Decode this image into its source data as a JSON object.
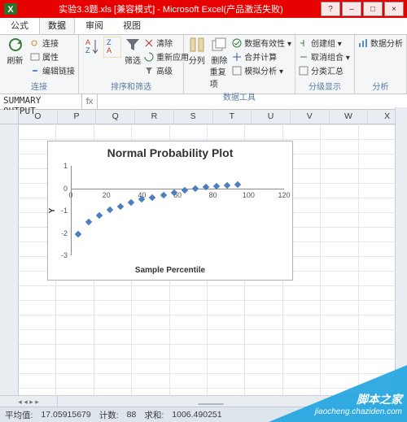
{
  "title": "实验3.3题.xls  [兼容模式] - Microsoft Excel(产品激活失败)",
  "winbtns": {
    "help": "?",
    "min": "–",
    "max": "□",
    "close": "×"
  },
  "tabs": {
    "t1": "公式",
    "t2": "数据",
    "t3": "审阅",
    "t4": "视图"
  },
  "ribbon": {
    "g1": {
      "big": "刷新",
      "r1": "连接",
      "r2": "属性",
      "r3": "编辑链接",
      "label": "连接"
    },
    "g2": {
      "filter": "筛选",
      "clear": "清除",
      "reapply": "重新应用",
      "adv": "高级",
      "label": "排序和筛选"
    },
    "g3": {
      "col1": "分列",
      "col2": "删除",
      "col3": "重复项",
      "label": "数据工具",
      "v1": "数据有效性 ▾",
      "v2": "合并计算",
      "v3": "模拟分析 ▾"
    },
    "g4": {
      "v1": "创建组 ▾",
      "v2": "取消组合 ▾",
      "v3": "分类汇总",
      "label": "分级显示"
    },
    "g5": {
      "v1": "数据分析",
      "label": "分析"
    }
  },
  "formula": {
    "name": "SUMMARY OUTPUT",
    "fx": "fx"
  },
  "cols": [
    "O",
    "P",
    "Q",
    "R",
    "S",
    "T",
    "U",
    "V",
    "W",
    "X"
  ],
  "cell_a": "",
  "chart_data": {
    "type": "scatter",
    "title": "Normal Probability Plot",
    "xlabel": "Sample Percentile",
    "ylabel": "Y",
    "xlim": [
      0,
      120
    ],
    "ylim": [
      -3,
      1
    ],
    "xticks": [
      0,
      20,
      40,
      60,
      80,
      100,
      120
    ],
    "yticks": [
      -3,
      -2,
      -1,
      0,
      1
    ],
    "points": [
      {
        "x": 4,
        "y": -2.05
      },
      {
        "x": 10,
        "y": -1.5
      },
      {
        "x": 16,
        "y": -1.2
      },
      {
        "x": 22,
        "y": -0.95
      },
      {
        "x": 28,
        "y": -0.8
      },
      {
        "x": 34,
        "y": -0.65
      },
      {
        "x": 40,
        "y": -0.5
      },
      {
        "x": 46,
        "y": -0.4
      },
      {
        "x": 52,
        "y": -0.3
      },
      {
        "x": 58,
        "y": -0.2
      },
      {
        "x": 64,
        "y": -0.1
      },
      {
        "x": 70,
        "y": -0.02
      },
      {
        "x": 76,
        "y": 0.05
      },
      {
        "x": 82,
        "y": 0.1
      },
      {
        "x": 88,
        "y": 0.13
      },
      {
        "x": 94,
        "y": 0.15
      }
    ]
  },
  "status": {
    "avg_l": "平均值:",
    "avg_v": "17.05915679",
    "cnt_l": "计数:",
    "cnt_v": "88",
    "sum_l": "求和:",
    "sum_v": "1006.490251"
  },
  "watermark": {
    "l1": "脚本之家",
    "l2": "jiaocheng.chaziden.com"
  }
}
